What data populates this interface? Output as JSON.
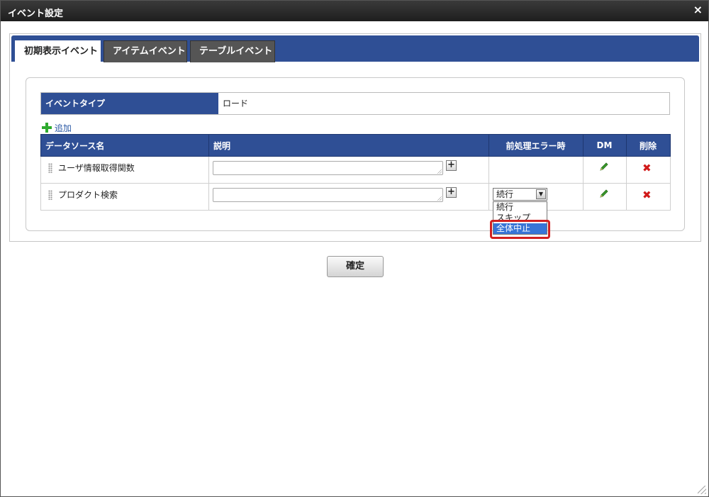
{
  "dialog": {
    "title": "イベント設定",
    "close_glyph": "×"
  },
  "tabs": [
    {
      "label": "初期表示イベント",
      "active": true
    },
    {
      "label": "アイテムイベント",
      "active": false
    },
    {
      "label": "テーブルイベント",
      "active": false
    }
  ],
  "event_type": {
    "label": "イベントタイプ",
    "value": "ロード"
  },
  "add_link": {
    "label": "追加"
  },
  "table": {
    "headers": [
      "データソース名",
      "説明",
      "前処理エラー時",
      "DM",
      "削除"
    ],
    "rows": [
      {
        "name": "ユーザ情報取得関数",
        "description": "",
        "error_action": ""
      },
      {
        "name": "プロダクト検索",
        "description": "",
        "error_action": "続行"
      }
    ]
  },
  "dropdown": {
    "options": [
      "続行",
      "スキップ",
      "全体中止"
    ],
    "highlighted": "全体中止"
  },
  "confirm_button": {
    "label": "確定"
  },
  "colors": {
    "header": "#2f4f95",
    "highlight_border": "#d12020",
    "selected_option": "#3875d7"
  }
}
